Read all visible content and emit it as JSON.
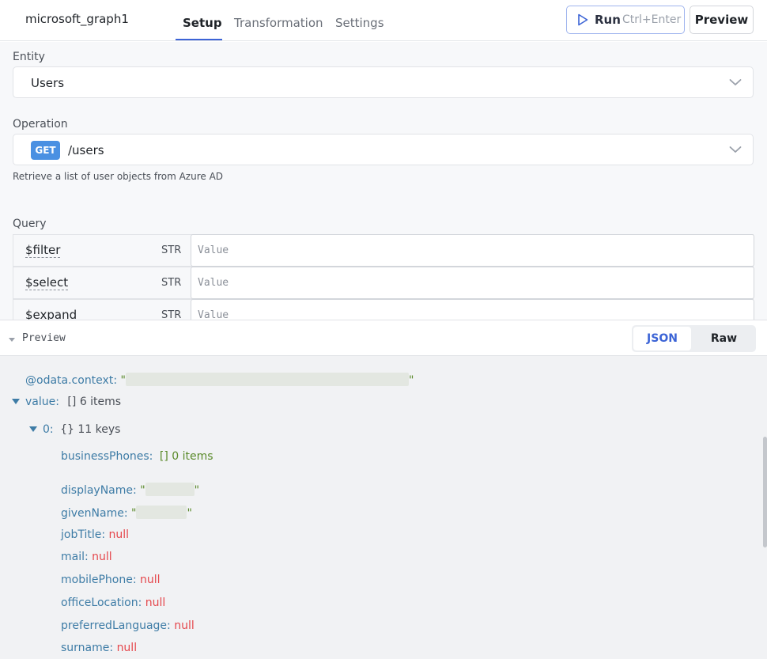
{
  "header": {
    "query_name": "microsoft_graph1",
    "tabs": [
      {
        "label": "Setup",
        "active": true
      },
      {
        "label": "Transformation",
        "active": false
      },
      {
        "label": "Settings",
        "active": false
      }
    ],
    "run_label": "Run",
    "run_shortcut": "Ctrl+Enter",
    "preview_label": "Preview"
  },
  "setup": {
    "entity_label": "Entity",
    "entity_value": "Users",
    "operation_label": "Operation",
    "operation_method": "GET",
    "operation_path": "/users",
    "operation_description": "Retrieve a list of user objects from Azure AD",
    "query_label": "Query",
    "query_params": [
      {
        "key": "$filter",
        "type": "STR",
        "placeholder": "Value"
      },
      {
        "key": "$select",
        "type": "STR",
        "placeholder": "Value"
      },
      {
        "key": "$expand",
        "type": "STR",
        "placeholder": "Value"
      }
    ]
  },
  "preview": {
    "label": "Preview",
    "modes": [
      "JSON",
      "Raw"
    ],
    "active_mode": "JSON"
  },
  "json_tree": {
    "context_key": "@odata.context:",
    "quote": "\"",
    "value_key": "value:",
    "value_type": "[]",
    "value_count": "6 items",
    "item_index": "0:",
    "item_type": "{}",
    "item_count": "11 keys",
    "business_phones_key": "businessPhones:",
    "business_phones_type": "[]",
    "business_phones_count": "0 items",
    "display_name_key": "displayName:",
    "given_name_key": "givenName:",
    "null_fields": [
      {
        "key": "jobTitle:",
        "value": "null"
      },
      {
        "key": "mail:",
        "value": "null"
      },
      {
        "key": "mobilePhone:",
        "value": "null"
      },
      {
        "key": "officeLocation:",
        "value": "null"
      },
      {
        "key": "preferredLanguage:",
        "value": "null"
      },
      {
        "key": "surname:",
        "value": "null"
      }
    ]
  },
  "colors": {
    "accent": "#3c64d6",
    "get_badge": "#4a90e2",
    "json_key": "#3e7ca6",
    "json_null": "#e5484d",
    "json_string": "#5a8a2a"
  },
  "icons": [
    "play-icon",
    "chevron-down-icon",
    "caret-down-icon"
  ]
}
